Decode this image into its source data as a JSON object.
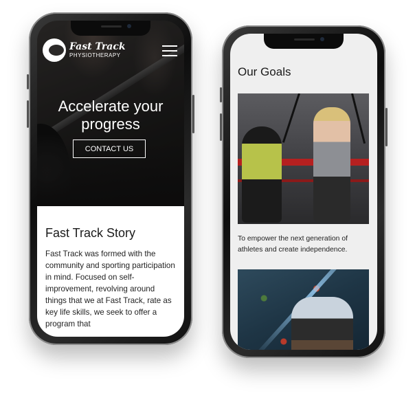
{
  "phone1": {
    "logo": {
      "line1": "Fast Track",
      "line2": "PHYSIOTHERAPY"
    },
    "hero": {
      "title_line1": "Accelerate your",
      "title_line2": "progress",
      "cta_label": "CONTACT US"
    },
    "story": {
      "heading": "Fast Track Story",
      "body": "Fast Track was formed with the community and sporting participation in mind. Focused on self-improvement, revolving around things that we at Fast Track, rate as key life skills, we seek to offer a program that"
    }
  },
  "phone2": {
    "title": "Our Goals",
    "goal1_text": "To empower the next generation of athletes and create independence."
  }
}
